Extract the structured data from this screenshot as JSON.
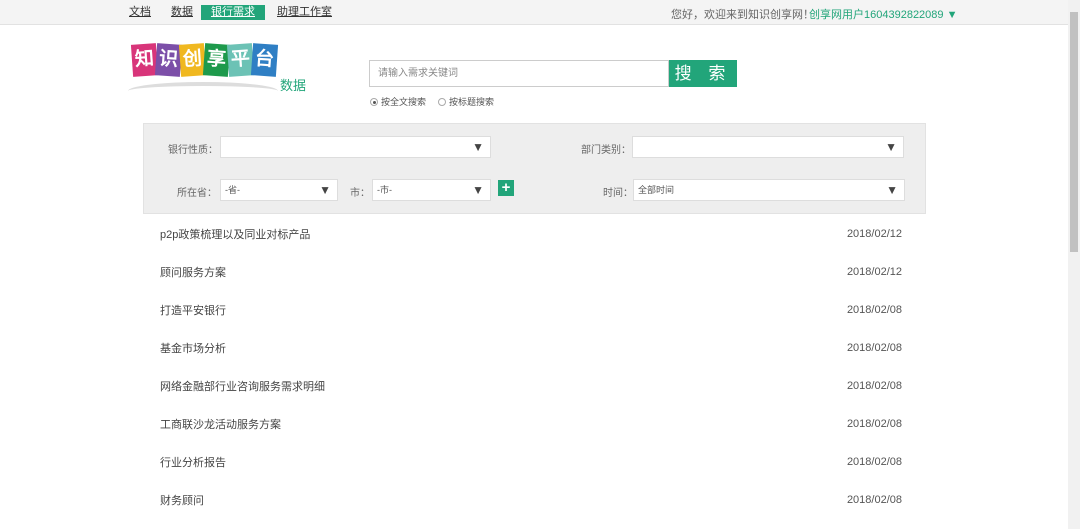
{
  "nav": {
    "items": [
      {
        "label": "文档"
      },
      {
        "label": "数据"
      },
      {
        "label": "银行需求",
        "active": true
      },
      {
        "label": "助理工作室"
      }
    ],
    "welcome": "您好，欢迎来到知识创享网！",
    "user": "创享网用户1604392822089 ▼"
  },
  "logo": {
    "tiles": [
      "知",
      "识",
      "创",
      "享",
      "平",
      "台"
    ],
    "sub": "数据",
    "colors": [
      "#d8357a",
      "#7c4fa8",
      "#f0b820",
      "#1e9a4c",
      "#6cc2b5",
      "#2f7fc4"
    ]
  },
  "search": {
    "placeholder": "请输入需求关键词",
    "button": "搜 索",
    "options": [
      {
        "label": "按全文搜索",
        "checked": true
      },
      {
        "label": "按标题搜索",
        "checked": false
      }
    ]
  },
  "filters": {
    "bank_type": {
      "label": "银行性质：",
      "value": ""
    },
    "dept_type": {
      "label": "部门类别：",
      "value": ""
    },
    "province": {
      "label": "所在省：",
      "value": "-省-"
    },
    "city": {
      "label": "市：",
      "value": "-市-"
    },
    "time": {
      "label": "时间：",
      "value": "全部时间"
    }
  },
  "list": [
    {
      "title": "p2p政策梳理以及同业对标产品",
      "date": "2018/02/12"
    },
    {
      "title": "顾问服务方案",
      "date": "2018/02/12"
    },
    {
      "title": "打造平安银行",
      "date": "2018/02/08"
    },
    {
      "title": "基金市场分析",
      "date": "2018/02/08"
    },
    {
      "title": "网络金融部行业咨询服务需求明细",
      "date": "2018/02/08"
    },
    {
      "title": "工商联沙龙活动服务方案",
      "date": "2018/02/08"
    },
    {
      "title": "行业分析报告",
      "date": "2018/02/08"
    },
    {
      "title": "财务顾问",
      "date": "2018/02/08"
    }
  ],
  "colors": {
    "accent": "#22a57a"
  }
}
